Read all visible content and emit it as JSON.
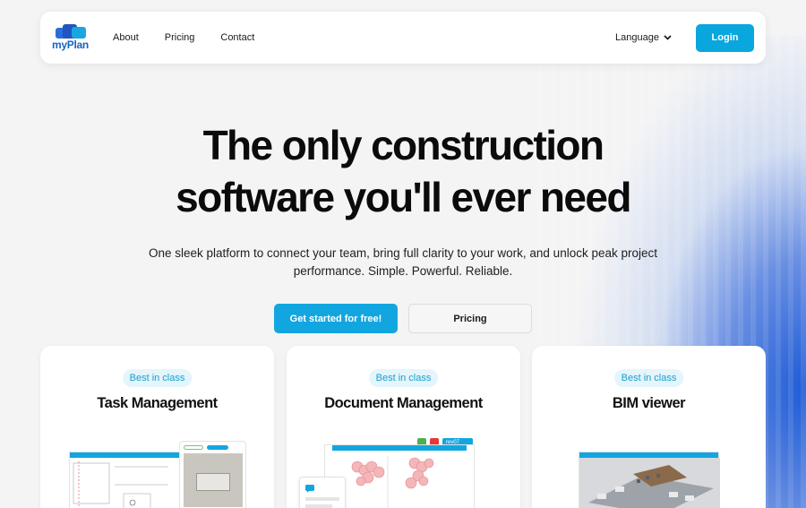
{
  "nav": {
    "logo_text": "myPlan",
    "links": [
      "About",
      "Pricing",
      "Contact"
    ],
    "language_label": "Language",
    "login_label": "Login"
  },
  "hero": {
    "title_line1": "The only construction",
    "title_line2": "software you'll ever need",
    "subtitle": "One sleek platform to connect your team, bring full clarity to your work, and unlock peak project performance. Simple. Powerful. Reliable.",
    "primary_cta": "Get started for free!",
    "secondary_cta": "Pricing"
  },
  "features": [
    {
      "badge": "Best in class",
      "title": "Task Management"
    },
    {
      "badge": "Best in class",
      "title": "Document Management"
    },
    {
      "badge": "Best in class",
      "title": "BIM viewer"
    }
  ],
  "mockups": {
    "doc_version_label": "rev07"
  },
  "colors": {
    "accent": "#12a6e0",
    "badge_bg": "#e4f5fb",
    "brand_blue": "#1565c0"
  }
}
